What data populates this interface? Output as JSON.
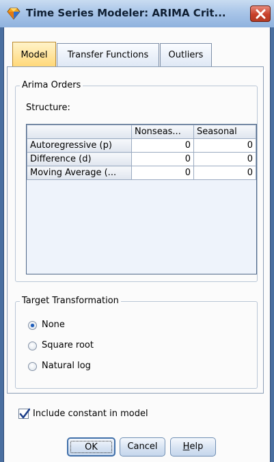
{
  "window": {
    "title": "Time Series Modeler: ARIMA Crit...",
    "title_bar_color": "#a9c5e8",
    "close_button_color": "#c8402a"
  },
  "tabs": [
    {
      "label": "Model",
      "active": true
    },
    {
      "label": "Transfer Functions",
      "active": false
    },
    {
      "label": "Outliers",
      "active": false
    }
  ],
  "arima_orders": {
    "group_title": "Arima Orders",
    "structure_label": "Structure:",
    "columns": [
      "",
      "Nonseas...",
      "Seasonal"
    ],
    "rows": [
      {
        "label": "Autoregressive (p)",
        "nonseasonal": "0",
        "seasonal": "0"
      },
      {
        "label": "Difference (d)",
        "nonseasonal": "0",
        "seasonal": "0"
      },
      {
        "label": "Moving Average (...",
        "nonseasonal": "0",
        "seasonal": "0"
      }
    ]
  },
  "target_transformation": {
    "group_title": "Target Transformation",
    "options": [
      {
        "label": "None",
        "checked": true
      },
      {
        "label": "Square root",
        "checked": false
      },
      {
        "label": "Natural log",
        "checked": false
      }
    ]
  },
  "include_constant": {
    "label": "Include constant in model",
    "checked": true
  },
  "buttons": {
    "ok": "OK",
    "cancel": "Cancel",
    "help_prefix": "",
    "help_mnemonic": "H",
    "help_suffix": "elp"
  },
  "icons": {
    "app": "diamond-app-icon",
    "close": "close-icon",
    "check": "checkmark-icon"
  }
}
